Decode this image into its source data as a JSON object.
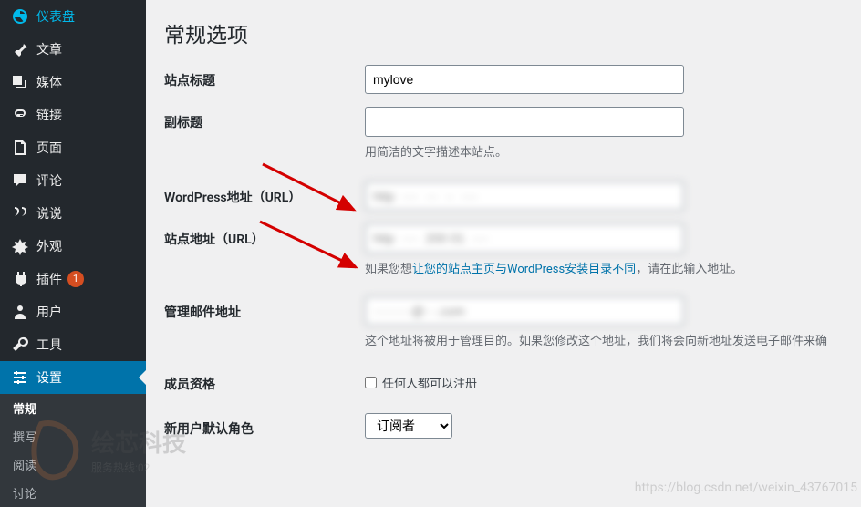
{
  "sidebar": {
    "items": [
      {
        "label": "仪表盘",
        "icon": "dashboard-icon"
      },
      {
        "label": "文章",
        "icon": "pin-icon"
      },
      {
        "label": "媒体",
        "icon": "media-icon"
      },
      {
        "label": "链接",
        "icon": "link-icon"
      },
      {
        "label": "页面",
        "icon": "page-icon"
      },
      {
        "label": "评论",
        "icon": "comment-icon"
      },
      {
        "label": "说说",
        "icon": "quote-icon"
      },
      {
        "label": "外观",
        "icon": "appearance-icon"
      },
      {
        "label": "插件",
        "icon": "plugin-icon",
        "badge": "1"
      },
      {
        "label": "用户",
        "icon": "user-icon"
      },
      {
        "label": "工具",
        "icon": "tool-icon"
      },
      {
        "label": "设置",
        "icon": "settings-icon",
        "current": true
      }
    ],
    "submenu": [
      {
        "label": "常规",
        "active": true
      },
      {
        "label": "撰写"
      },
      {
        "label": "阅读"
      },
      {
        "label": "讨论"
      }
    ]
  },
  "page": {
    "title": "常规选项"
  },
  "form": {
    "site_title": {
      "label": "站点标题",
      "value": "mylove"
    },
    "tagline": {
      "label": "副标题",
      "value": "",
      "description": "用简洁的文字描述本站点。"
    },
    "wp_url": {
      "label": "WordPress地址（URL）",
      "value": ""
    },
    "site_url": {
      "label": "站点地址（URL）",
      "value": "",
      "desc_prefix": "如果您想",
      "desc_link": "让您的站点主页与WordPress安装目录不同",
      "desc_suffix": "，请在此输入地址。"
    },
    "admin_email": {
      "label": "管理邮件地址",
      "value": "",
      "description": "这个地址将被用于管理目的。如果您修改这个地址，我们将会向新地址发送电子邮件来确"
    },
    "membership": {
      "label": "成员资格",
      "checkbox_label": "任何人都可以注册"
    },
    "default_role": {
      "label": "新用户默认角色",
      "selected": "订阅者"
    }
  },
  "watermark": "https://blog.csdn.net/weixin_43767015"
}
